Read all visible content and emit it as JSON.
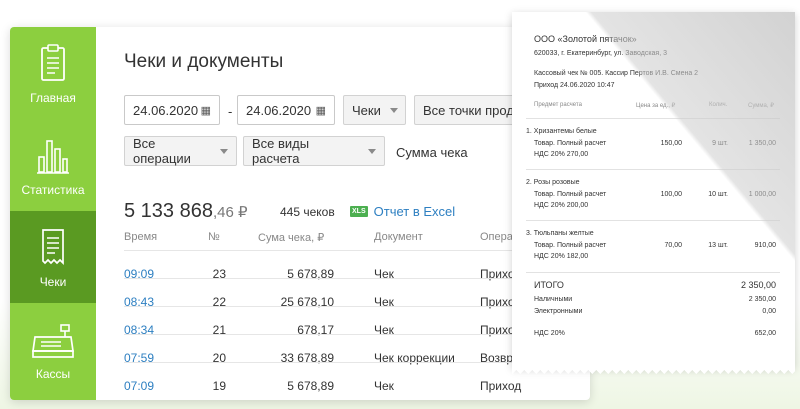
{
  "sidebar": {
    "items": [
      {
        "label": "Главная",
        "icon": "clipboard-icon"
      },
      {
        "label": "Статистика",
        "icon": "bar-chart-icon"
      },
      {
        "label": "Чеки",
        "icon": "receipt-icon"
      },
      {
        "label": "Кассы",
        "icon": "cash-register-icon"
      }
    ],
    "active": "Чеки",
    "colors": {
      "sidebar": "#8ccf3f",
      "active": "#5a9a22"
    }
  },
  "page": {
    "title": "Чеки и документы",
    "filters": {
      "date_from": "24.06.2020",
      "date_to": "24.06.2020",
      "doc_type": "Чеки",
      "points": "Все точки прода",
      "operations": "Все операции",
      "payment_types": "Все виды расчета",
      "sum_label": "Сумма чека"
    },
    "total": {
      "rub": "5 133 868",
      "kop": ",46 ₽",
      "count": "445 чеков"
    },
    "excel": {
      "badge": "XLS",
      "label": "Отчет в Excel"
    },
    "table": {
      "headers": [
        "Время",
        "№",
        "Сума чека, ₽",
        "Документ",
        "Операц"
      ],
      "rows": [
        {
          "time": "09:09",
          "num": "23",
          "sum": "5 678,89",
          "doc": "Чек",
          "op": "Приход"
        },
        {
          "time": "08:43",
          "num": "22",
          "sum": "25 678,10",
          "doc": "Чек",
          "op": "Приход"
        },
        {
          "time": "08:34",
          "num": "21",
          "sum": "678,17",
          "doc": "Чек",
          "op": "Приход"
        },
        {
          "time": "07:59",
          "num": "20",
          "sum": "33 678,89",
          "doc": "Чек коррекции",
          "op": "Возвр"
        },
        {
          "time": "07:09",
          "num": "19",
          "sum": "5 678,89",
          "doc": "Чек",
          "op": "Приход"
        }
      ]
    },
    "link_color": "#2d7fc1"
  },
  "receipt": {
    "company": "ООО «Золотой пятачок»",
    "address": "620033, г. Екатеринбург, ул. Заводская, 3",
    "cashier_line": "Кассовый чек № 005. Кассир Пертов И.В. Смена 2",
    "arrival_line": "Приход 24.06.2020 10:47",
    "headers": [
      "Предмет расчета",
      "Цена за ед., ₽",
      "Колич.",
      "Сумма, ₽"
    ],
    "items": [
      {
        "name": "1. Хризантемы белые",
        "kind": "Товар. Полный расчет",
        "vat": "НДС 20% 270,00",
        "price": "150,00",
        "qty": "9 шт.",
        "sum": "1 350,00"
      },
      {
        "name": "2. Розы розовые",
        "kind": "Товар. Полный расчет",
        "vat": "НДС 20% 200,00",
        "price": "100,00",
        "qty": "10 шт.",
        "sum": "1 000,00"
      },
      {
        "name": "3. Тюльпаны желтые",
        "kind": "Товар. Полный расчет",
        "vat": "НДС 20% 182,00",
        "price": "70,00",
        "qty": "13 шт.",
        "sum": "910,00"
      }
    ],
    "total_label": "ИТОГО",
    "total_value": "2 350,00",
    "cash_label": "Наличными",
    "cash_value": "2 350,00",
    "electronic_label": "Электронными",
    "electronic_value": "0,00",
    "vat_label": "НДС 20%",
    "vat_value": "652,00"
  }
}
